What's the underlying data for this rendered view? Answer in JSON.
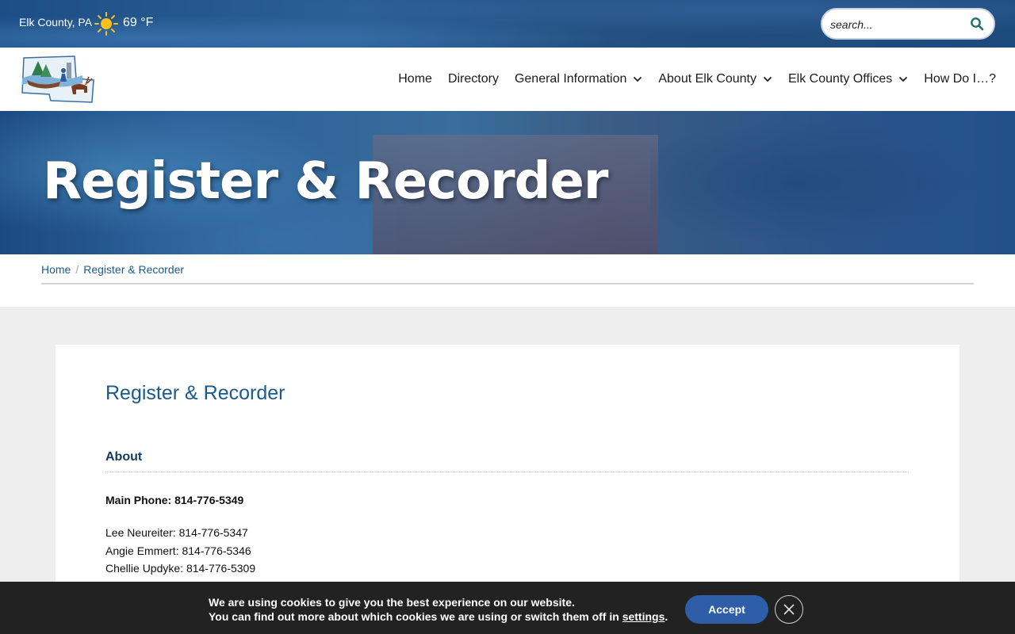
{
  "topbar": {
    "location": "Elk County, PA",
    "weather_icon": "sun-icon",
    "temperature": "69 °F",
    "search_placeholder": "search...",
    "search_icon": "search-icon"
  },
  "nav": {
    "items": [
      {
        "label": "Home",
        "has_dropdown": false
      },
      {
        "label": "Directory",
        "has_dropdown": false
      },
      {
        "label": "General Information",
        "has_dropdown": true
      },
      {
        "label": "About Elk County",
        "has_dropdown": true
      },
      {
        "label": "Elk County Offices",
        "has_dropdown": true
      },
      {
        "label": "How Do I…?",
        "has_dropdown": false
      }
    ]
  },
  "hero": {
    "title": "Register & Recorder"
  },
  "breadcrumb": {
    "home": "Home",
    "separator": "/",
    "current": "Register & Recorder"
  },
  "content": {
    "title": "Register & Recorder",
    "section_heading": "About",
    "main_phone": "Main Phone: 814-776-5349",
    "contacts": [
      "Lee Neureiter: 814-776-5347",
      "Angie Emmert: 814-776-5346",
      "Chellie Updyke: 814-776-5309"
    ]
  },
  "cookie": {
    "line1": "We are using cookies to give you the best experience on our website.",
    "line2_prefix": "You can find out more about which cookies we are using or switch them off in ",
    "line2_link": "settings",
    "line2_suffix": ".",
    "accept_label": "Accept",
    "close_icon": "close-icon"
  },
  "colors": {
    "link_blue": "#1d5a8e",
    "heading_navy": "#123a5e",
    "accept_button": "#2e5ea8",
    "cookie_bar": "#222222"
  }
}
